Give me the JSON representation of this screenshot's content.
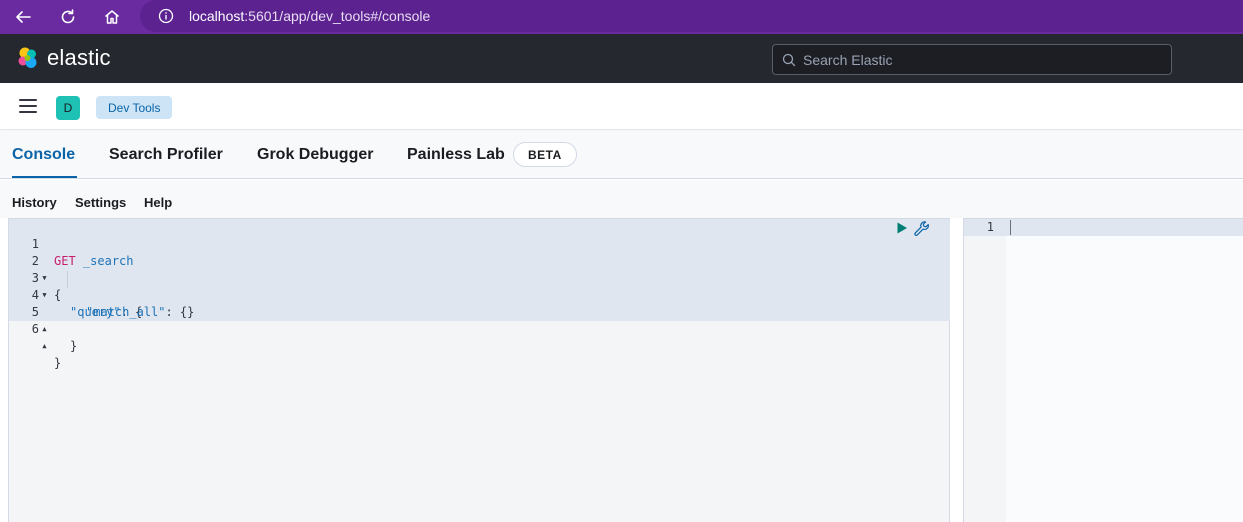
{
  "browser": {
    "url_host": "localhost",
    "url_rest": ":5601/app/dev_tools#/console"
  },
  "header": {
    "brand": "elastic",
    "search_placeholder": "Search Elastic"
  },
  "breadcrumbs": {
    "space_initial": "D",
    "current": "Dev Tools"
  },
  "tabs": [
    {
      "label": "Console",
      "active": true
    },
    {
      "label": "Search Profiler",
      "active": false
    },
    {
      "label": "Grok Debugger",
      "active": false
    },
    {
      "label": "Painless Lab",
      "active": false
    }
  ],
  "beta_badge": "BETA",
  "console_menu": {
    "history": "History",
    "settings": "Settings",
    "help": "Help"
  },
  "editor": {
    "lines": [
      {
        "num": "1",
        "fold": ""
      },
      {
        "num": "2",
        "fold": "▼"
      },
      {
        "num": "3",
        "fold": "▼"
      },
      {
        "num": "4",
        "fold": ""
      },
      {
        "num": "5",
        "fold": "▲"
      },
      {
        "num": "6",
        "fold": "▲"
      }
    ],
    "method": "GET",
    "path": "_search",
    "line2": "{",
    "line3_key": "\"query\"",
    "line3_rest": ": {",
    "line4_key": "\"match_all\"",
    "line4_rest": ": {}",
    "line5": "}",
    "line6": "}"
  },
  "output": {
    "line_num": "1"
  },
  "colors": {
    "browser_bar": "#6a2ba0",
    "header_bg": "#25282f",
    "accent": "#0b64a8",
    "method": "#c61e6d",
    "run_button": "#017d73"
  }
}
